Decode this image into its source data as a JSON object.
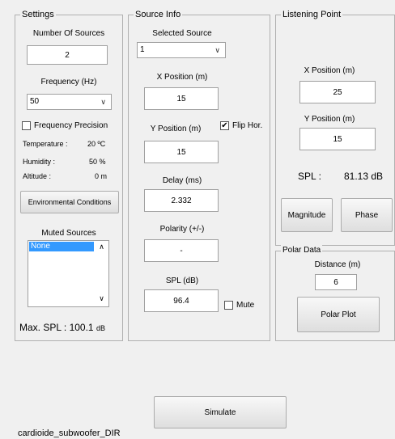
{
  "settings": {
    "title": "Settings",
    "num_sources_label": "Number Of Sources",
    "num_sources_value": "2",
    "frequency_label": "Frequency (Hz)",
    "frequency_value": "50",
    "frequency_precision_label": "Frequency Precision",
    "frequency_precision_checked": false,
    "temperature_label": "Temperature :",
    "temperature_value": "20 ºC",
    "humidity_label": "Humidity :",
    "humidity_value": "50 %",
    "altitude_label": "Altitude :",
    "altitude_value": "0 m",
    "env_button": "Environmental Conditions",
    "muted_label": "Muted Sources",
    "muted_items": [
      "None"
    ],
    "max_spl_prefix": "Max. SPL : 100.1",
    "max_spl_unit": "dB"
  },
  "source": {
    "title": "Source Info",
    "selected_label": "Selected Source",
    "selected_value": "1",
    "x_label": "X Position (m)",
    "x_value": "15",
    "y_label": "Y Position (m)",
    "y_value": "15",
    "flip_label": "Flip Hor.",
    "flip_checked": true,
    "delay_label": "Delay (ms)",
    "delay_value": "2.332",
    "polarity_label": "Polarity (+/-)",
    "polarity_value": "-",
    "spl_label": "SPL (dB)",
    "spl_value": "96.4",
    "mute_label": "Mute",
    "mute_checked": false
  },
  "listening": {
    "title": "Listening Point",
    "x_label": "X Position (m)",
    "x_value": "25",
    "y_label": "Y Position (m)",
    "y_value": "15",
    "spl_label": "SPL :",
    "spl_value": "81.13 dB",
    "magnitude_button": "Magnitude",
    "phase_button": "Phase"
  },
  "polar": {
    "title": "Polar Data",
    "distance_label": "Distance (m)",
    "distance_value": "6",
    "plot_button": "Polar Plot"
  },
  "simulate_button": "Simulate",
  "file_name": "cardioide_subwoofer_DIR"
}
